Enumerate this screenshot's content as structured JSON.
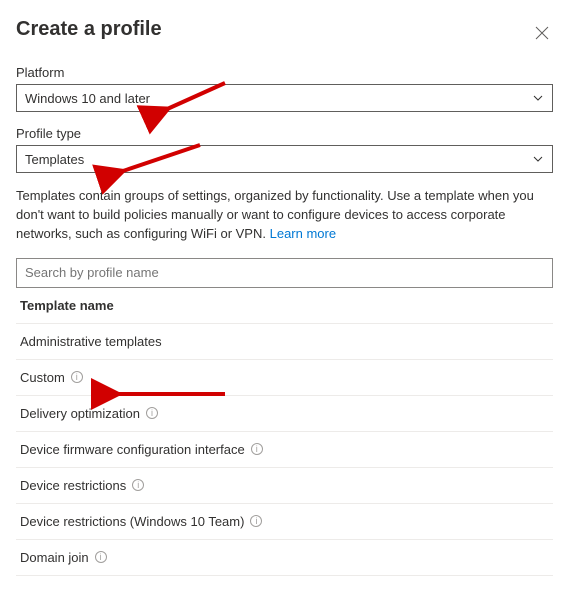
{
  "header": {
    "title": "Create a profile"
  },
  "platform": {
    "label": "Platform",
    "value": "Windows 10 and later"
  },
  "profileType": {
    "label": "Profile type",
    "value": "Templates"
  },
  "description": {
    "text": "Templates contain groups of settings, organized by functionality. Use a template when you don't want to build policies manually or want to configure devices to access corporate networks, such as configuring WiFi or VPN.",
    "learnMore": "Learn more"
  },
  "search": {
    "placeholder": "Search by profile name"
  },
  "table": {
    "columnHeader": "Template name",
    "rows": [
      {
        "name": "Administrative templates",
        "info": false
      },
      {
        "name": "Custom",
        "info": true
      },
      {
        "name": "Delivery optimization",
        "info": true
      },
      {
        "name": "Device firmware configuration interface",
        "info": true
      },
      {
        "name": "Device restrictions",
        "info": true
      },
      {
        "name": "Device restrictions (Windows 10 Team)",
        "info": true
      },
      {
        "name": "Domain join",
        "info": true
      }
    ]
  }
}
